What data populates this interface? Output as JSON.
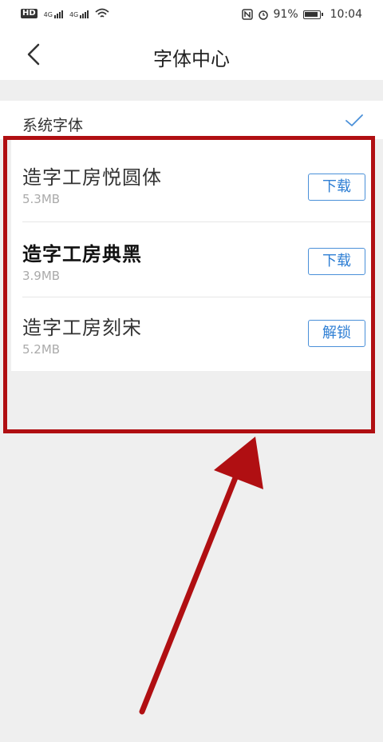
{
  "status_bar": {
    "left_badges": [
      "HD",
      "4G",
      "4G"
    ],
    "battery_percent": "91%",
    "time": "10:04",
    "icons": [
      "hd-icon",
      "signal-icon",
      "signal-icon",
      "wifi-icon",
      "nfc-icon",
      "alarm-icon",
      "battery-icon"
    ]
  },
  "header": {
    "title": "字体中心",
    "back_icon": "chevron-left-icon"
  },
  "system_font": {
    "label": "系统字体",
    "selected_icon": "checkmark-icon"
  },
  "fonts": [
    {
      "name": "造字工房悦圆体",
      "size": "5.3MB",
      "action": "下载"
    },
    {
      "name": "造字工房典黑",
      "size": "3.9MB",
      "action": "下载"
    },
    {
      "name": "造字工房刻宋",
      "size": "5.2MB",
      "action": "解锁"
    }
  ],
  "colors": {
    "accent": "#2f7fd4",
    "annotation": "#b00f12"
  }
}
